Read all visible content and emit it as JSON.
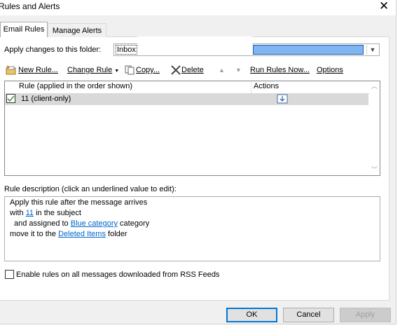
{
  "window": {
    "title": "Rules and Alerts"
  },
  "tabs": [
    {
      "label": "Email Rules"
    },
    {
      "label": "Manage Alerts"
    }
  ],
  "folder": {
    "label": "Apply changes to this folder:",
    "value": "Inbox"
  },
  "toolbar": {
    "new_rule": "New Rule...",
    "change_rule": "Change Rule",
    "copy": "Copy...",
    "delete": "Delete",
    "run_rules_now": "Run Rules Now...",
    "options": "Options"
  },
  "rules_list": {
    "col_rule": "Rule (applied in the order shown)",
    "col_actions": "Actions",
    "rows": [
      {
        "name": "11  (client-only)",
        "checked": true
      }
    ]
  },
  "description": {
    "label": "Rule description (click an underlined value to edit):",
    "line1": "Apply this rule after the message arrives",
    "line2_pre": "with ",
    "line2_link": "11",
    "line2_post": " in the subject",
    "line3_pre": "and assigned to ",
    "line3_link": "Blue category",
    "line3_post": " category",
    "line4_pre": "move it to the ",
    "line4_link": "Deleted Items",
    "line4_post": " folder"
  },
  "rss": {
    "label": "Enable rules on all messages downloaded from RSS Feeds",
    "checked": false
  },
  "buttons": {
    "ok": "OK",
    "cancel": "Cancel",
    "apply": "Apply"
  },
  "colors": {
    "accent": "#0078d7",
    "link": "#0066cc",
    "selection": "#d9d9d9"
  }
}
